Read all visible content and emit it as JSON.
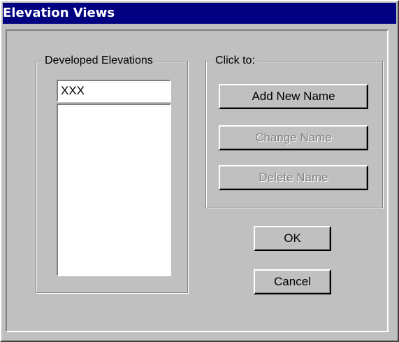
{
  "window": {
    "title": "Elevation Views"
  },
  "developed_elevations": {
    "label": "Developed Elevations",
    "input_value": "XXX",
    "items": []
  },
  "actions": {
    "label": "Click to:",
    "add_new_name": "Add New Name",
    "change_name": "Change Name",
    "delete_name": "Delete Name"
  },
  "dialog_buttons": {
    "ok": "OK",
    "cancel": "Cancel"
  },
  "colors": {
    "window_background": "#c0c0c0",
    "title_bar": "#000080",
    "title_text": "#ffffff",
    "disabled_text": "#808080",
    "field_background": "#ffffff"
  }
}
